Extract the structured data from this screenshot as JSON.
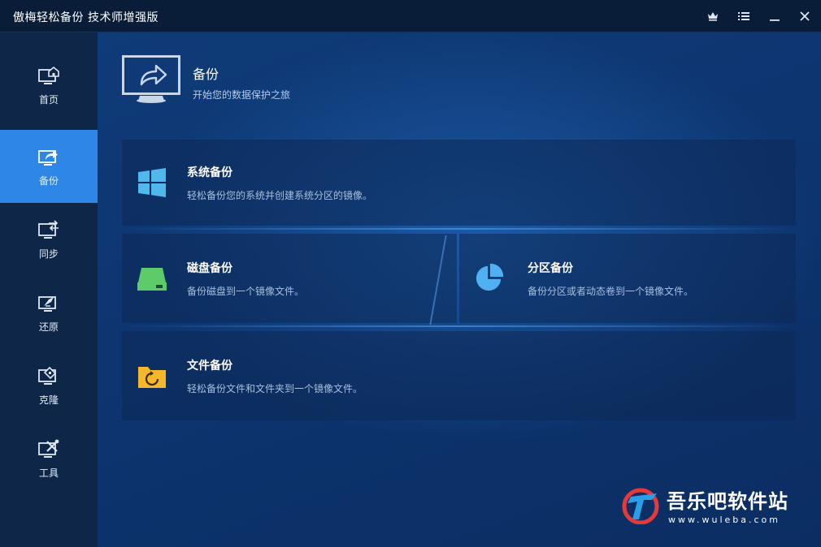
{
  "window": {
    "title": "傲梅轻松备份 技术师增强版"
  },
  "sidebar": {
    "items": [
      {
        "label": "首页"
      },
      {
        "label": "备份"
      },
      {
        "label": "同步"
      },
      {
        "label": "还原"
      },
      {
        "label": "克隆"
      },
      {
        "label": "工具"
      }
    ],
    "active_index": 1
  },
  "header": {
    "title": "备份",
    "subtitle": "开始您的数据保护之旅"
  },
  "cards": {
    "system": {
      "title": "系统备份",
      "desc": "轻松备份您的系统并创建系统分区的镜像。"
    },
    "disk": {
      "title": "磁盘备份",
      "desc": "备份磁盘到一个镜像文件。"
    },
    "partition": {
      "title": "分区备份",
      "desc": "备份分区或者动态卷到一个镜像文件。"
    },
    "file": {
      "title": "文件备份",
      "desc": "轻松备份文件和文件夹到一个镜像文件。"
    }
  },
  "watermark": {
    "main": "吾乐吧软件站",
    "sub": "www.wuleba.com"
  },
  "colors": {
    "accent": "#2e86e6",
    "disk_icon": "#5ecb6b",
    "partition_icon": "#4fb0f2",
    "file_icon": "#f5b72c",
    "windows_icon": "#4fb9ee"
  }
}
